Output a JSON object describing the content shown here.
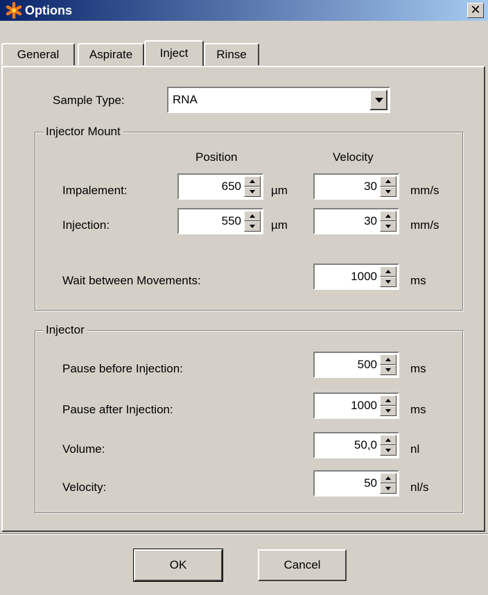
{
  "window": {
    "title": "Options",
    "close_glyph": "✕"
  },
  "tabs": [
    {
      "label": "General"
    },
    {
      "label": "Aspirate"
    },
    {
      "label": "Inject"
    },
    {
      "label": "Rinse"
    }
  ],
  "sample_type": {
    "label": "Sample Type:",
    "value": "RNA"
  },
  "injector_mount": {
    "title": "Injector Mount",
    "col_position": "Position",
    "col_velocity": "Velocity",
    "rows": [
      {
        "label": "Impalement:",
        "position": "650",
        "position_unit": "µm",
        "velocity": "30",
        "velocity_unit": "mm/s"
      },
      {
        "label": "Injection:",
        "position": "550",
        "position_unit": "µm",
        "velocity": "30",
        "velocity_unit": "mm/s"
      }
    ],
    "wait": {
      "label": "Wait between Movements:",
      "value": "1000",
      "unit": "ms"
    }
  },
  "injector": {
    "title": "Injector",
    "rows": [
      {
        "label": "Pause before Injection:",
        "value": "500",
        "unit": "ms"
      },
      {
        "label": "Pause after Injection:",
        "value": "1000",
        "unit": "ms"
      },
      {
        "label": "Volume:",
        "value": "50,0",
        "unit": "nl"
      },
      {
        "label": "Velocity:",
        "value": "50",
        "unit": "nl/s"
      }
    ]
  },
  "buttons": {
    "ok": "OK",
    "cancel": "Cancel"
  },
  "colors": {
    "titlebar_start": "#0a246a",
    "titlebar_end": "#a6caf0",
    "face": "#d4d0c8"
  },
  "icons": {
    "app": "asterisk-app-icon",
    "close": "close-icon",
    "dropdown": "chevron-down-icon",
    "spin": "spin-arrows-icon"
  }
}
